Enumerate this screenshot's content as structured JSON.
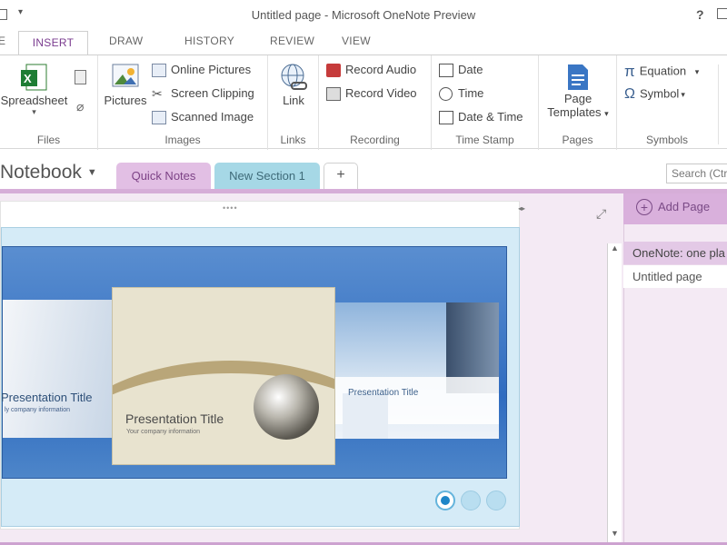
{
  "window": {
    "title": "Untitled page - Microsoft OneNote Preview",
    "help": "?"
  },
  "tabs": [
    "E",
    "INSERT",
    "DRAW",
    "HISTORY",
    "REVIEW",
    "VIEW"
  ],
  "ribbon": {
    "files": {
      "label": "Files",
      "spreadsheet": "Spreadsheet"
    },
    "images": {
      "label": "Images",
      "pictures": "Pictures",
      "online_pictures": "Online Pictures",
      "screen_clipping": "Screen Clipping",
      "scanned_image": "Scanned Image"
    },
    "links": {
      "label": "Links",
      "link": "Link"
    },
    "recording": {
      "label": "Recording",
      "record_audio": "Record Audio",
      "record_video": "Record Video"
    },
    "time_stamp": {
      "label": "Time Stamp",
      "date": "Date",
      "time": "Time",
      "date_time": "Date & Time"
    },
    "pages": {
      "label": "Pages",
      "page_templates_1": "Page",
      "page_templates_2": "Templates"
    },
    "symbols": {
      "label": "Symbols",
      "equation": "Equation",
      "symbol": "Symbol"
    }
  },
  "notebook": {
    "name": "Notebook",
    "sections": [
      "Quick Notes",
      "New Section 1"
    ],
    "add_section": "+",
    "search_placeholder": "Search (Ctr"
  },
  "carousel": {
    "slides": [
      {
        "title": "Presentation Title",
        "subtitle": "ly company information"
      },
      {
        "title": "Presentation Title",
        "subtitle": "Your company information"
      },
      {
        "title": "Presentation Title"
      }
    ],
    "dots_total": 3,
    "dots_active": 1
  },
  "pages_pane": {
    "add_page": "Add Page",
    "pages": [
      "OneNote: one pla",
      "Untitled page"
    ]
  },
  "colors": {
    "accent_purple": "#7a3b8f",
    "quick_notes_tab": "#e2bfe4",
    "new_section_tab": "#a6d8e6",
    "carousel_blue": "#2f6cc0"
  }
}
